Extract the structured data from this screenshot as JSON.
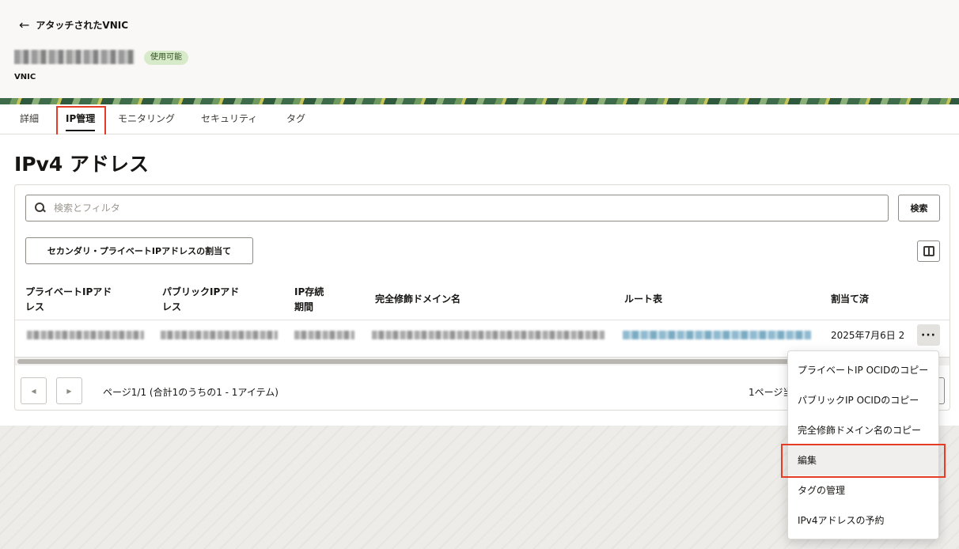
{
  "header": {
    "back_label": "アタッチされたVNIC",
    "status_badge": "使用可能",
    "resource_type": "VNIC"
  },
  "tabs": [
    {
      "label": "詳細"
    },
    {
      "label": "IP管理"
    },
    {
      "label": "モニタリング"
    },
    {
      "label": "セキュリティ"
    },
    {
      "label": "タグ"
    }
  ],
  "active_tab": "IP管理",
  "page": {
    "heading": "IPv4 アドレス"
  },
  "search": {
    "placeholder": "検索とフィルタ",
    "button_label": "検索"
  },
  "actions": {
    "assign_label": "セカンダリ・プライベートIPアドレスの割当て",
    "columns_icon": "columns-icon"
  },
  "table": {
    "columns": [
      {
        "line1": "プライベートIPアド",
        "line2": "レス"
      },
      {
        "line1": "パブリックIPアド",
        "line2": "レス"
      },
      {
        "line1": "IP存続",
        "line2": "期間"
      },
      {
        "line1": "完全修飾ドメイン名",
        "line2": ""
      },
      {
        "line1": "ルート表",
        "line2": ""
      },
      {
        "line1": "割当て済",
        "line2": ""
      }
    ],
    "rows": [
      {
        "assigned": "2025年7月6日 2"
      }
    ],
    "row_action": "···"
  },
  "pagination": {
    "info": "ページ1/1 (合計1のうちの1 - 1アイテム)",
    "per_page": "1ページ当たり"
  },
  "menu": {
    "items": [
      {
        "label": "プライベートIP OCIDのコピー"
      },
      {
        "label": "パブリックIP OCIDのコピー"
      },
      {
        "label": "完全修飾ドメイン名のコピー"
      },
      {
        "label": "編集"
      },
      {
        "label": "タグの管理"
      },
      {
        "label": "IPv4アドレスの予約"
      }
    ]
  },
  "colors": {
    "highlight": "#e63b24",
    "badge_bg": "#d7eac9"
  }
}
